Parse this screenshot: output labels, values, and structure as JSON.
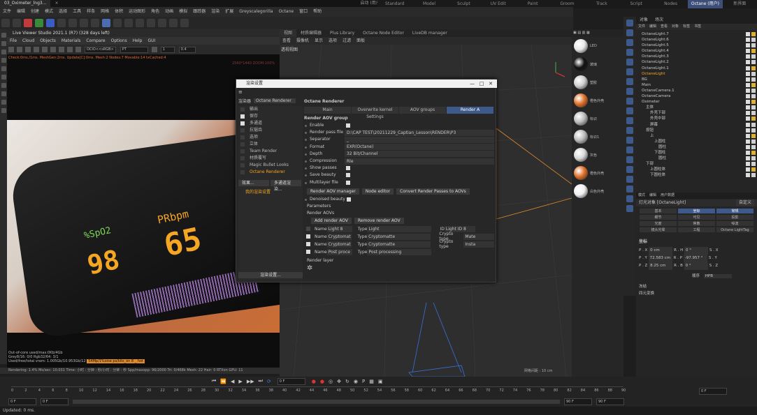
{
  "topbar": {
    "file_tab": "03_Oximeter_lng3...",
    "start_label": "启动 (用户)"
  },
  "layouts": [
    "Standard",
    "Model",
    "Sculpt",
    "UV Edit",
    "Paint",
    "Groom",
    "Track",
    "Script",
    "Nodes",
    "Octane (用户)",
    "新界面"
  ],
  "menubar": [
    "文件",
    "编辑",
    "创建",
    "模式",
    "选择",
    "工具",
    "样条",
    "网格",
    "体积",
    "运动图形",
    "角色",
    "动画",
    "模拟",
    "跟踪器",
    "渲染",
    "扩展",
    "Greyscalegorilla",
    "Octane",
    "窗口",
    "帮助"
  ],
  "live_viewer": {
    "title": "Live Viewer Studio 2021.1 (R7) (328 days left)",
    "menu": [
      "File",
      "Cloud",
      "Objects",
      "Materials",
      "Compare",
      "Options",
      "Help",
      "GUI"
    ],
    "select_value": "OCIO<<sRGB>",
    "mode": "PT",
    "num1": "1",
    "num2": "0.4",
    "status": "Check:0ms./1ms. MeshGen:2ms. Update[C]:0ms. Mesh:2 Nodes:7 Movable:14 txCached:4",
    "resolution": "2560*1440 ZOOM:100%",
    "overlay_1": "%SpO2",
    "overlay_2": "PRbpm",
    "overlay_3": "98",
    "overlay_4": "65",
    "bottom": [
      "Out-of-core used/max:0Kb/4Gb",
      "Grey8/16: 0/0          Rgb32/64: 3/1",
      "Used/free/total vram: 1.005Gb/10.953Gb/12"
    ],
    "bottom_highlight": "54Mp/1%oise ps/kilo_on 8  _ hot"
  },
  "render_status": "Rendering: 1.4%   Ms/sec: 10.031   Time: 小时 : 分钟 : 秒/小时 : 分钟 : 秒   Spp/maxspp: 96/2000   Tri: 0/468k   Mesh: 22   Hair: 0   RTXon   GPU: 11",
  "viewport": {
    "tabs": [
      "视图",
      "材质编辑器",
      "Plus Library",
      "Octane Node Editor",
      "LiveDB manager"
    ],
    "menu": [
      "查看",
      "摄像机",
      "显示",
      "选项",
      "过滤",
      "面板"
    ],
    "label": "透视视图",
    "grid": "网格间距 : 10 cm"
  },
  "materials": [
    "LED",
    "玻璃",
    "塑胶",
    "橙色外壳",
    "标识",
    "标识1",
    "灰色",
    "橙色外壳",
    "白色外壳"
  ],
  "object_manager": {
    "tabs": [
      "对象",
      "场次"
    ],
    "menu": [
      "文件",
      "编辑",
      "查看",
      "对象",
      "标签",
      "书签"
    ],
    "objects": [
      {
        "name": "OctaneLight.7",
        "sel": false
      },
      {
        "name": "OctaneLight.6",
        "sel": false
      },
      {
        "name": "OctaneLight.5",
        "sel": false
      },
      {
        "name": "OctaneLight.4",
        "sel": false
      },
      {
        "name": "OctaneLight.3",
        "sel": false
      },
      {
        "name": "OctaneLight.2",
        "sel": false
      },
      {
        "name": "OctaneLight.1",
        "sel": false
      },
      {
        "name": "OctaneLight",
        "sel": true
      },
      {
        "name": "BG",
        "sel": false
      },
      {
        "name": "Main",
        "sel": false
      },
      {
        "name": "OctaneCamera.1",
        "sel": false
      },
      {
        "name": "OctaneCamera",
        "sel": false
      },
      {
        "name": "Oximeter",
        "sel": false
      },
      {
        "name": "主体",
        "sel": false
      },
      {
        "name": "外壳下部",
        "sel": false
      },
      {
        "name": "外壳中部",
        "sel": false
      },
      {
        "name": "屏幕",
        "sel": false
      },
      {
        "name": "按钮",
        "sel": false
      },
      {
        "name": "上",
        "sel": false
      },
      {
        "name": "上圆柱",
        "sel": false
      },
      {
        "name": "圆柱",
        "sel": false
      },
      {
        "name": "下圆柱",
        "sel": false
      },
      {
        "name": "圆柱",
        "sel": false
      },
      {
        "name": "下部",
        "sel": false
      },
      {
        "name": "上圆柱体",
        "sel": false
      },
      {
        "name": "下圆柱体",
        "sel": false
      }
    ]
  },
  "attributes": {
    "tabs": [
      "模式",
      "编辑",
      "用户数据"
    ],
    "header": "灯光对象 [OctaneLight]",
    "header_btn": "自定义",
    "row1": [
      "基本",
      "坐标",
      "常规"
    ],
    "row2": [
      "细节",
      "可见",
      "投影"
    ],
    "row3": [
      "光度",
      "焦散",
      "噪波"
    ],
    "row4": [
      "镜头光晕",
      "工程",
      "Octane LightTag"
    ],
    "section": "坐标",
    "coords": [
      {
        "a": "P . X",
        "av": "0 cm",
        "b": "R . H",
        "bv": "0 °",
        "c": "S . X"
      },
      {
        "a": "P . Y",
        "av": "72.583 cm",
        "b": "R . P",
        "bv": "-97.957 °",
        "c": "S . Y"
      },
      {
        "a": "P . Z",
        "av": "8.25 cm",
        "b": "R . B",
        "bv": "0 °",
        "c": "S . Z"
      }
    ],
    "order_label": "顺序",
    "order_value": "HPB",
    "extra": [
      "冻结",
      "四元变换"
    ]
  },
  "dialog": {
    "title": "渲染设置",
    "renderer_label": "渲染器",
    "renderer_value": "Octane Renderer",
    "sidebar": [
      {
        "label": "输出",
        "cb": false,
        "on": false
      },
      {
        "label": "保存",
        "cb": true,
        "on": false
      },
      {
        "label": "多通道",
        "cb": true,
        "on": false
      },
      {
        "label": "抗锯齿",
        "cb": false,
        "on": false
      },
      {
        "label": "选项",
        "cb": false,
        "on": false
      },
      {
        "label": "立体",
        "cb": false,
        "on": false
      },
      {
        "label": "Team Render",
        "cb": false,
        "on": false
      },
      {
        "label": "材质覆写",
        "cb": false,
        "on": false
      },
      {
        "label": "Magic Bullet Looks",
        "cb": false,
        "on": false
      },
      {
        "label": "Octane Renderer",
        "cb": false,
        "on": true
      }
    ],
    "effect_btn": "效果...",
    "multi_btn": "多通道渲染...",
    "my_settings": "我的渲染设置",
    "render_settings_btn": "渲染设置...",
    "main_title": "Octane Renderer",
    "tabs": [
      "Main",
      "Overwrite kernel Settings",
      "AOV groups",
      "Render A"
    ],
    "group_title": "Render AOV group",
    "fields": [
      {
        "label": "Enable",
        "value": "",
        "check": true
      },
      {
        "label": "Render pass file",
        "value": "D:\\CAP TEST\\20211229_Captian_Lesson\\RENDER\\P3",
        "check": false
      },
      {
        "label": "Separator",
        "value": "_",
        "check": false
      },
      {
        "label": "Format",
        "value": "EXR(Octane)",
        "check": false
      },
      {
        "label": "Depth",
        "value": "32 Bit/Channel",
        "check": false
      },
      {
        "label": "Compression",
        "value": "Rle",
        "check": false
      },
      {
        "label": "Show passes",
        "value": "",
        "check": true
      },
      {
        "label": "Save beauty",
        "value": "",
        "check": true
      },
      {
        "label": "Multilayer file",
        "value": "",
        "check": true
      }
    ],
    "buttons": [
      "Render AOV manager",
      "Node editor",
      "Convert Render Passes to AOVs"
    ],
    "denoised": "Denoised beauty",
    "parameters": "Parameters",
    "render_aovs": "Render AOVs",
    "add_btn": "Add render AOV",
    "remove_btn": "Remove render AOV",
    "aovs": [
      {
        "checked": false,
        "name": "Light 8",
        "type": "Light",
        "extra_label": "ID",
        "extra_value": "Light ID 8"
      },
      {
        "checked": true,
        "name": "Cryptomat",
        "type": "Cryptomatte",
        "extra_label": "Crypto type",
        "extra_value": "Mate"
      },
      {
        "checked": true,
        "name": "Cryptomat",
        "type": "Cryptomatte",
        "extra_label": "Crypto type",
        "extra_value": "Insta"
      },
      {
        "checked": true,
        "name": "Post proce",
        "type": "Post processing",
        "extra_label": "",
        "extra_value": ""
      }
    ],
    "name_label": "Name",
    "type_label": "Type",
    "render_layer": "Render layer"
  },
  "timeline": {
    "ticks": [
      "0",
      "2",
      "4",
      "6",
      "8",
      "10",
      "12",
      "14",
      "16",
      "18",
      "20",
      "22",
      "24",
      "26",
      "28",
      "30",
      "32",
      "34",
      "36",
      "38",
      "40",
      "42",
      "44",
      "46",
      "48",
      "50",
      "52",
      "54",
      "56",
      "58",
      "60",
      "62",
      "64",
      "66",
      "68",
      "70",
      "72",
      "74",
      "76",
      "78",
      "80",
      "82",
      "84",
      "86",
      "88",
      "90"
    ],
    "frame": "0 F",
    "start": "0 F",
    "start2": "0 F",
    "end": "90 F",
    "end2": "90 F",
    "right": "0 F"
  },
  "statusbar": "Updated: 0 ms."
}
